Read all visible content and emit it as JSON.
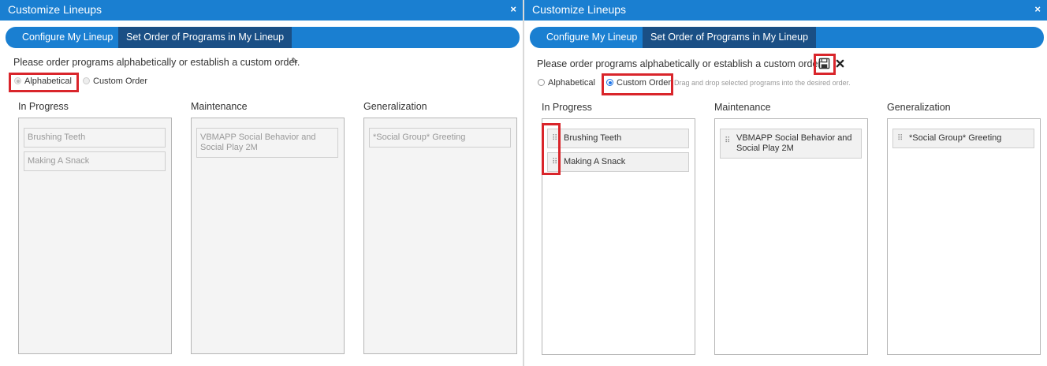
{
  "dialog": {
    "title": "Customize Lineups",
    "close_glyph": "×"
  },
  "tabs": [
    {
      "label": "Configure My Lineup"
    },
    {
      "label": "Set Order of Programs in My Lineup"
    }
  ],
  "instruction": "Please order programs alphabetically or establish a custom order.",
  "radios": {
    "alphabetical": "Alphabetical",
    "custom": "Custom Order"
  },
  "drag_hint": "Drag and drop selected programs into the desired order.",
  "columns": {
    "in_progress": {
      "label": "In Progress",
      "items": [
        "Brushing Teeth",
        "Making A Snack"
      ]
    },
    "maintenance": {
      "label": "Maintenance",
      "items": [
        "VBMAPP Social Behavior and Social Play 2M"
      ]
    },
    "generalization": {
      "label": "Generalization",
      "items": [
        "*Social Group* Greeting"
      ]
    }
  },
  "left_panel": {
    "selected_order": "alphabetical",
    "editable": false
  },
  "right_panel": {
    "selected_order": "custom",
    "editable": true
  },
  "icons": {
    "edit": "pencil-icon",
    "save": "save-icon",
    "cancel": "x-icon",
    "drag": "drag-handle-icon"
  },
  "colors": {
    "header_blue": "#1a7fd1",
    "active_tab": "#1a4f85",
    "highlight_red": "#d9252b"
  }
}
